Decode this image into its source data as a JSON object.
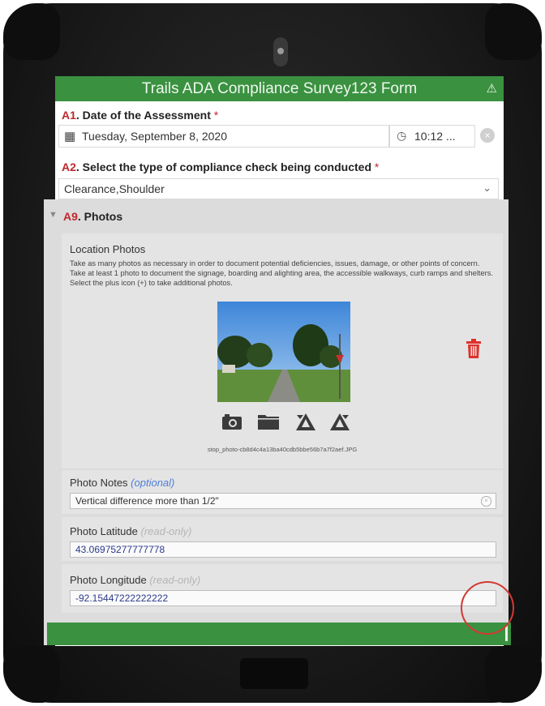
{
  "form": {
    "title": "Trails ADA Compliance Survey123 Form",
    "warning_icon": "warning-triangle-icon"
  },
  "q_a1": {
    "number": "A1",
    "label": ". Date of the Assessment",
    "required_mark": "*",
    "date_value": "Tuesday, September 8, 2020",
    "time_value": "10:12 ...",
    "clear_symbol": "×"
  },
  "q_a2": {
    "number": "A2",
    "label": ". Select the type of compliance check being conducted",
    "required_mark": "*",
    "selected_value": "Clearance,Shoulder",
    "chevron": "⌄"
  },
  "q_a9": {
    "expand_symbol": "▼",
    "number": "A9",
    "label": ". Photos",
    "location_photos": {
      "title": "Location Photos",
      "description": "Take as many photos as necessary in order to document potential deficiencies, issues, damage, or other points of concern. Take at least 1 photo to document the signage, boarding and alighting area, the accessible walkways, curb ramps and shelters. Select the plus icon (+) to take additional photos.",
      "filename": "stop_photo-cb8d4c4a13ba40cdb5bbe56b7a7f2aef.JPG"
    },
    "photo_notes": {
      "label": "Photo Notes",
      "hint": "(optional)",
      "value": "Vertical difference more than 1/2\""
    },
    "photo_latitude": {
      "label": "Photo Latitude",
      "hint": "(read-only)",
      "value": "43.06975277777778"
    },
    "photo_longitude": {
      "label": "Photo Longitude",
      "hint": "(read-only)",
      "value": "-92.15447222222222"
    }
  },
  "colors": {
    "header_green": "#3a9140",
    "required_red": "#c0272d",
    "hint_blue": "#4f7fd9",
    "delete_red": "#e0302a",
    "annotation_ring": "#d23a32"
  }
}
